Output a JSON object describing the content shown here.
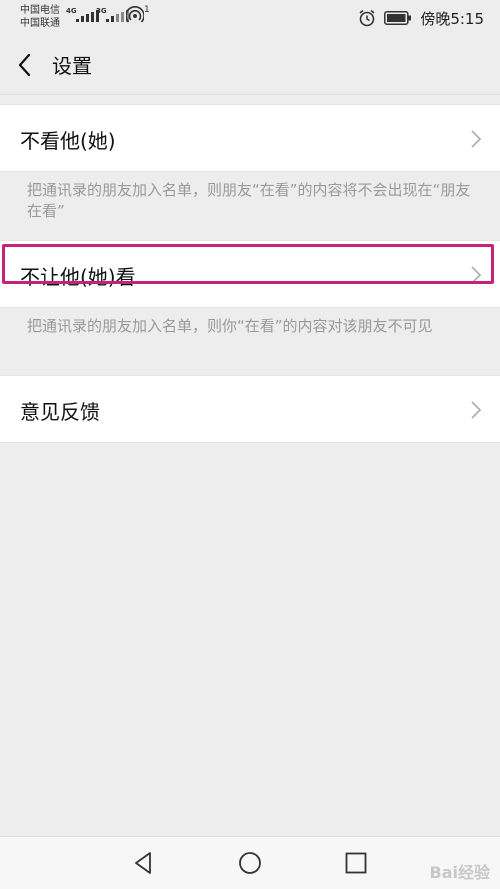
{
  "status_bar": {
    "carrier_1": "中国电信",
    "carrier_2": "中国联通",
    "network_1": "4G",
    "network_2": "3G",
    "hotspot_count": "1",
    "time": "傍晚5:15"
  },
  "header": {
    "title": "设置",
    "back_icon": "chevron-left-icon"
  },
  "settings": [
    {
      "label": "不看他(她)",
      "description": "把通讯录的朋友加入名单，则朋友“在看”的内容将不会出现在“朋友在看”"
    },
    {
      "label": "不让他(她)看",
      "description": "把通讯录的朋友加入名单，则你“在看”的内容对该朋友不可见"
    },
    {
      "label": "意见反馈"
    }
  ],
  "nav_bar": {
    "back_icon": "triangle-back-icon",
    "home_icon": "circle-home-icon",
    "recent_icon": "square-recent-icon"
  },
  "watermark": "Bai经验",
  "colors": {
    "background": "#ededed",
    "row_background": "#ffffff",
    "description_text": "#9a9a9a",
    "highlight_border": "#c1247a"
  }
}
